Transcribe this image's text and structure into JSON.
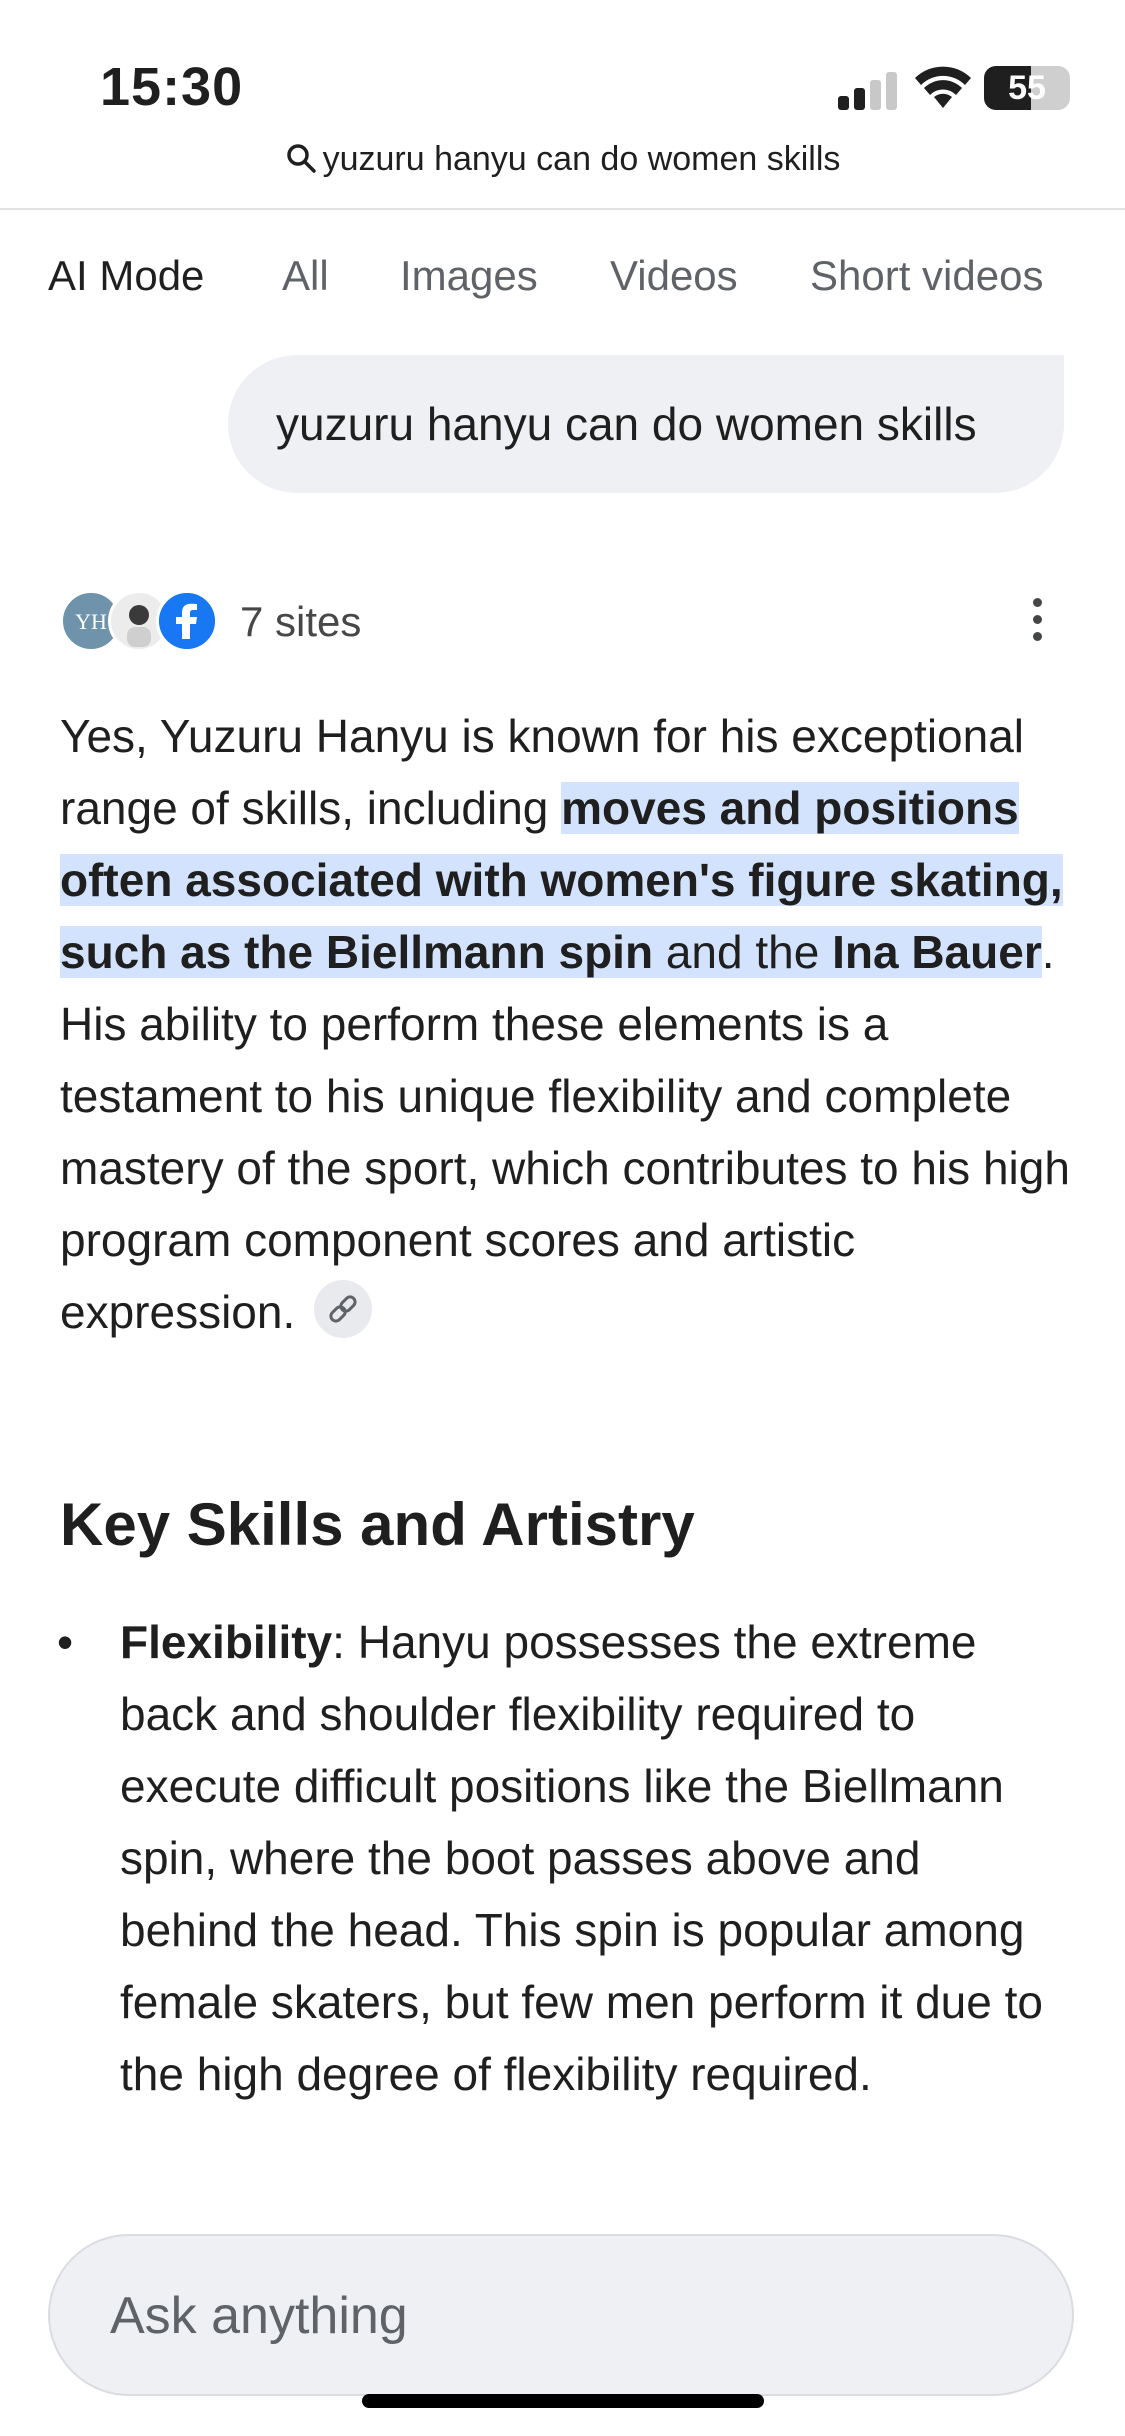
{
  "status_bar": {
    "time": "15:30",
    "battery_percent": "55",
    "signal_bars_active": 2,
    "signal_bars_total": 4
  },
  "search": {
    "query": "yuzuru hanyu can do women skills",
    "icon": "search-icon"
  },
  "tabs": [
    {
      "label": "AI Mode",
      "active": true
    },
    {
      "label": "All",
      "active": false
    },
    {
      "label": "Images",
      "active": false
    },
    {
      "label": "Videos",
      "active": false
    },
    {
      "label": "Short videos",
      "active": false
    }
  ],
  "query_bubble": "yuzuru hanyu can do women skills",
  "sources": {
    "label": "7 sites",
    "favicons": [
      "yh-logo-icon",
      "person-avatar-icon",
      "facebook-icon"
    ],
    "menu_icon": "more-vert-icon"
  },
  "answer": {
    "intro": "Yes, Yuzuru Hanyu is known for his exceptional range of skills, including ",
    "highlight_bold_1": "moves and positions often associated with women's figure skating, such as the ",
    "highlight_term_1": "Biellmann spin",
    "highlight_mid": " and the ",
    "highlight_term_2": "Ina Bauer",
    "rest": ". His ability to perform these elements is a testament to his unique flexibility and complete mastery of the sport, which contributes to his high program component scores and artistic expression.",
    "link_icon": "link-icon"
  },
  "section": {
    "heading": "Key Skills and Artistry",
    "bullets": [
      {
        "term": "Flexibility",
        "text": ": Hanyu possesses the extreme back and shoulder flexibility required to execute difficult positions like the Biellmann spin, where the boot passes above and behind the head. This spin is popular among female skaters, but few men perform it due to the high degree of flexibility required."
      }
    ]
  },
  "ask_box": {
    "placeholder": "Ask anything"
  },
  "colors": {
    "highlight": "#d3e3fd",
    "bubble": "#eef0f4",
    "text": "#1f1f1f",
    "muted": "#5f6368",
    "facebook": "#1877f2"
  }
}
